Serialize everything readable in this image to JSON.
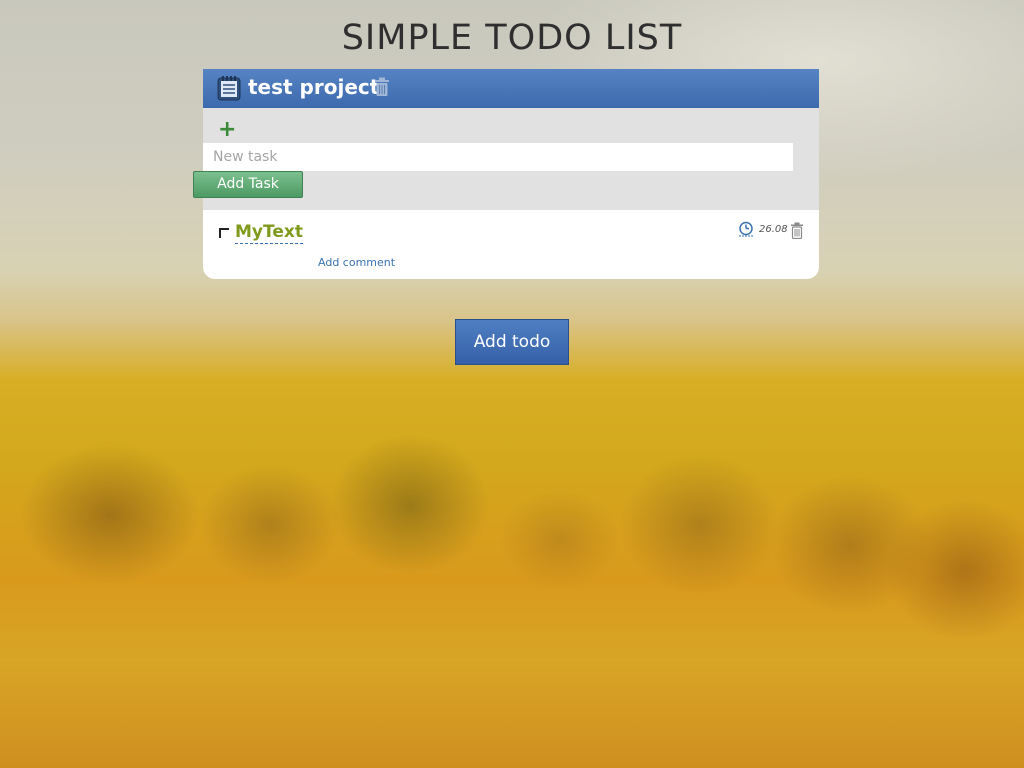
{
  "page": {
    "title": "SIMPLE TODO LIST"
  },
  "project": {
    "title": "test project",
    "icons": {
      "project": "notepad-icon",
      "delete": "trash-icon"
    },
    "add_panel": {
      "plus_icon": "+",
      "input_placeholder": "New task",
      "input_value": "",
      "add_button_label": "Add Task"
    },
    "tasks": [
      {
        "text": "MyText",
        "checked": false,
        "deadline": "26.08",
        "add_comment_label": "Add comment",
        "icons": {
          "deadline": "clock-icon",
          "delete": "trash-icon"
        }
      }
    ]
  },
  "footer": {
    "add_todo_label": "Add todo"
  },
  "colors": {
    "header_blue": "#3d6aad",
    "add_task_green": "#4d9a63",
    "task_text_olive": "#7f9a1c",
    "link_blue": "#3b73b0",
    "add_todo_blue": "#3560a8"
  }
}
